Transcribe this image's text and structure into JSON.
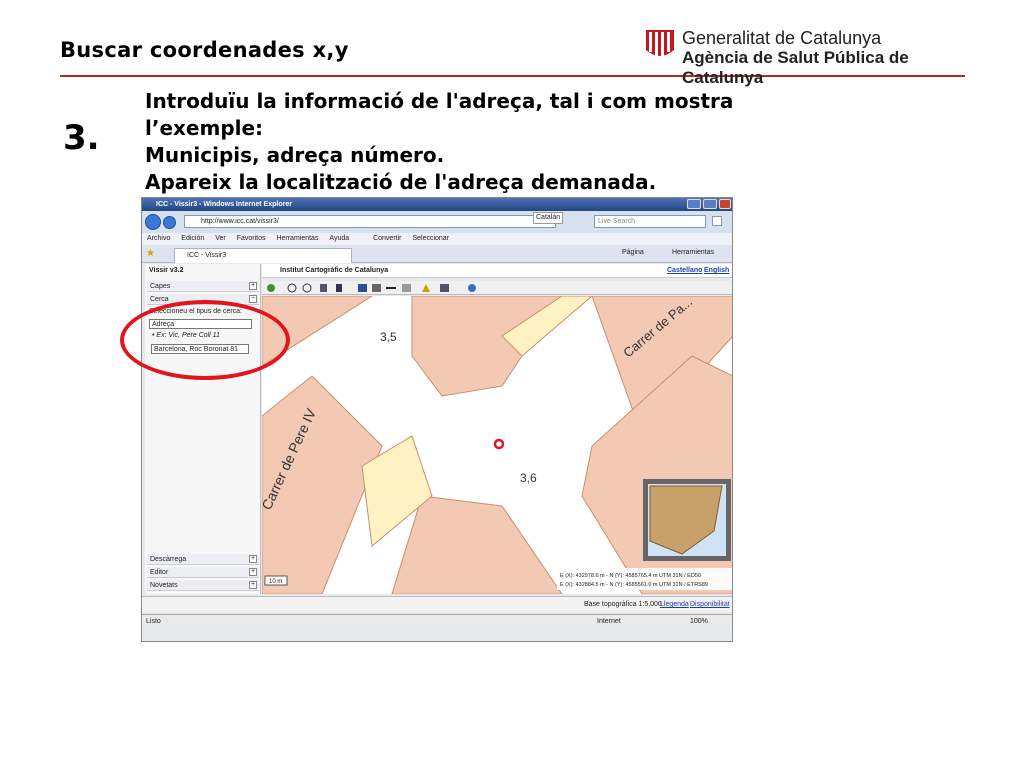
{
  "slide": {
    "title": "Buscar coordenades x,y",
    "step_number": "3.",
    "instructions": [
      "Introduïu la informació de l'adreça, tal i com mostra l’exemple:",
      "Municipis, adreça  número.",
      "Apareix la localització de l'adreça demanada."
    ],
    "logo_line1": "Generalitat de Catalunya",
    "logo_line2": "Agència de Salut Pública de Catalunya",
    "accent_color": "#b22a1e",
    "highlight_color": "#e3141d"
  },
  "browser": {
    "window_title": "ICC - Vissir3 - Windows Internet Explorer",
    "url": "http://www.icc.cat/vissir3/",
    "language_label": "Catalán",
    "search_placeholder": "Live Search",
    "menu": [
      "Archivo",
      "Edición",
      "Ver",
      "Favoritos",
      "Herramientas",
      "Ayuda"
    ],
    "convert_label": "Convertir",
    "select_label": "Seleccionar",
    "tab_label": "ICC - Vissir3",
    "page_label": "Página",
    "tools_label": "Herramientas",
    "status_text": "Listo",
    "zone_label": "Internet",
    "zoom_label": "100%"
  },
  "app": {
    "version": "Vissir v3.2",
    "header_title": "Institut Cartogràfic de Catalunya",
    "lang_castellano": "Castellano",
    "lang_english": "English",
    "sidebar_sections": [
      "Capes",
      "Cerca",
      "Descàrrega",
      "Editor",
      "Novetats"
    ],
    "search_type_label": "Seleccioneu el tipus de cerca:",
    "search_type_value": "Adreça",
    "example_text": "• Ex: Vic, Pere Coll 11",
    "address_value": "Barcelona, Roc Boronat 81",
    "base_info": "Base topogràfica 1:5.000",
    "legend_link": "Llegenda",
    "availability_link": "Disponibilitat",
    "scale_bar": "10 m",
    "coord_line1": "E (X): 432978.6 m - N (Y): 4585765.4 m UTM 31N / ED50",
    "coord_line2": "E (X): 432884.5 m - N (Y): 4585561.0 m UTM 31N / ETRS89"
  },
  "map": {
    "street_1": "Carrer de Pere IV",
    "street_2": "Carrer de Pa...",
    "height_1": "3,5",
    "height_2": "3,6"
  }
}
